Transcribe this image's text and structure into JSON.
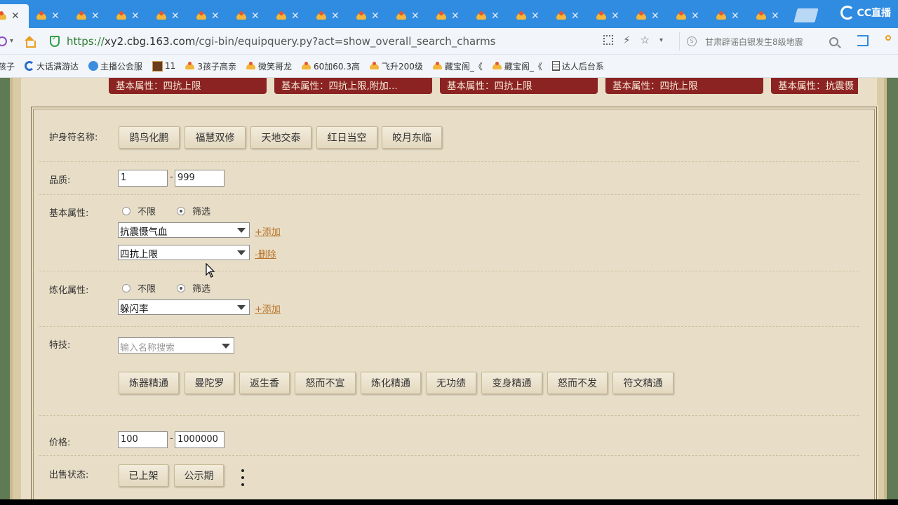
{
  "browser": {
    "tabs_count": 20,
    "active_tab_index": 0,
    "brand": "CC直播",
    "url": {
      "protocol": "https://",
      "host": "xy2.cbg.163.com",
      "path": "/cgi-bin/equipquery.py?act=show_overall_search_charms"
    },
    "search_text": "甘肃辟谣白银发生8级地震",
    "bookmarks": [
      "孩子",
      "大话满游达",
      "主播公会服",
      "11",
      "3孩子高亲",
      "微笑哥龙",
      "60加60.3高",
      "飞升200级",
      "藏宝阁_《",
      "藏宝阁_《",
      "达人后台系"
    ],
    "bookmark_icons": [
      "none",
      "c-icon",
      "globe-icon",
      "game-icon",
      "chick-icon",
      "chick-icon",
      "chick-icon",
      "chick-icon",
      "chick-icon",
      "chick-icon",
      "doc-icon"
    ]
  },
  "chips": [
    "基本属性：四抗上限",
    "基本属性：四抗上限,附加...",
    "基本属性：四抗上限",
    "基本属性：四抗上限",
    "基本属性：抗震慑"
  ],
  "form": {
    "charm_name_label": "护身符名称:",
    "charm_names": [
      "鹍鸟化鹏",
      "福慧双修",
      "天地交泰",
      "红日当空",
      "皎月东临"
    ],
    "quality_label": "品质:",
    "quality_min": "1",
    "quality_max": "999",
    "range_dash": "-",
    "basic_attr_label": "基本属性:",
    "radio_unlimited": "不限",
    "radio_filter": "筛选",
    "basic_attr_1": "抗震慑气血",
    "basic_attr_2": "四抗上限",
    "add_link": "+添加",
    "delete_link": "-删除",
    "refine_attr_label": "炼化属性:",
    "refine_attr_1": "躲闪率",
    "skill_label": "特技:",
    "skill_placeholder": "输入名称搜索",
    "skills": [
      "炼器精通",
      "曼陀罗",
      "返生香",
      "怒而不宣",
      "炼化精通",
      "无功绩",
      "变身精通",
      "怒而不发",
      "符文精通"
    ],
    "price_label": "价格:",
    "price_min": "100",
    "price_max": "1000000",
    "sale_status_label": "出售状态:",
    "sale_status": [
      "已上架",
      "公示期"
    ]
  },
  "colors": {
    "tabstrip": "#2f8ce0",
    "chip_bg": "#8c2323",
    "page_bg": "#e9dfc8",
    "link": "#b8742a"
  }
}
